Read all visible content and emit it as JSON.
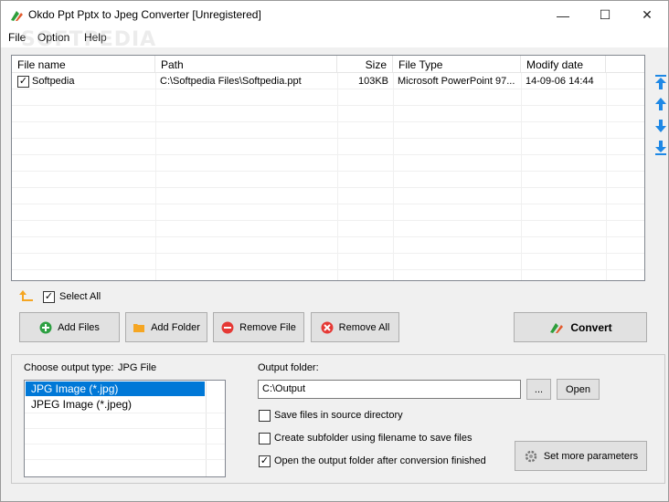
{
  "window": {
    "title": "Okdo Ppt Pptx to Jpeg Converter [Unregistered]",
    "minimize_glyph": "—",
    "maximize_glyph": "☐",
    "close_glyph": "✕"
  },
  "menu": {
    "file": "File",
    "option": "Option",
    "help": "Help"
  },
  "watermark": "SOFTPEDIA",
  "file_list": {
    "columns": {
      "name": "File name",
      "path": "Path",
      "size": "Size",
      "type": "File Type",
      "modified": "Modify date"
    },
    "rows": [
      {
        "checked": true,
        "name": "Softpedia",
        "path": "C:\\Softpedia Files\\Softpedia.ppt",
        "size": "103KB",
        "type": "Microsoft PowerPoint 97...",
        "modified": "14-09-06 14:44"
      }
    ]
  },
  "side_icons": [
    "move-top-icon",
    "move-up-icon",
    "move-down-icon",
    "move-bottom-icon"
  ],
  "select_all": {
    "label": "Select All",
    "checked": true
  },
  "buttons": {
    "add_files": "Add Files",
    "add_folder": "Add Folder",
    "remove_file": "Remove File",
    "remove_all": "Remove All",
    "convert": "Convert"
  },
  "output": {
    "type_label": "Choose output type:",
    "type_value": "JPG File",
    "types": [
      "JPG Image (*.jpg)",
      "JPEG Image (*.jpeg)"
    ],
    "selected_type": "JPG Image (*.jpg)",
    "folder_label": "Output folder:",
    "folder_value": "C:\\Output",
    "browse_label": "...",
    "open_label": "Open",
    "options": [
      {
        "label": "Save files in source directory",
        "checked": false
      },
      {
        "label": "Create subfolder using filename to save files",
        "checked": false
      },
      {
        "label": "Open the output folder after conversion finished",
        "checked": true
      }
    ],
    "params_label": "Set more parameters"
  },
  "colors": {
    "selection": "#0078d7",
    "arrow_blue": "#1e88e5",
    "add_green": "#2ea043",
    "folder_orange": "#f5a623",
    "remove_red": "#e53935"
  }
}
